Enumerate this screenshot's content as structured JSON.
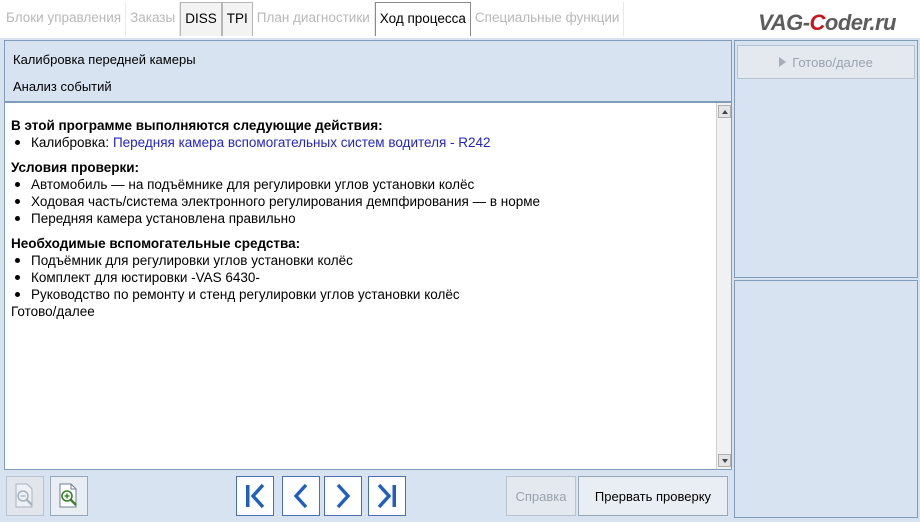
{
  "tabs": [
    {
      "label": "Блоки управления",
      "state": "disabled"
    },
    {
      "label": "Заказы",
      "state": "disabled"
    },
    {
      "label": "DISS",
      "state": "enabled"
    },
    {
      "label": "TPI",
      "state": "enabled"
    },
    {
      "label": "План диагностики",
      "state": "disabled"
    },
    {
      "label": "Ход процесса",
      "state": "active"
    },
    {
      "label": "Специальные функции",
      "state": "disabled"
    }
  ],
  "watermark": {
    "part1": "VAG-",
    "part2": "C",
    "part3": "oder.ru"
  },
  "header": {
    "title": "Калибровка передней камеры",
    "subtitle": "Анализ событий"
  },
  "content": {
    "section1_heading": "В этой программе выполняются следующие действия:",
    "section1_item_prefix": "Калибровка: ",
    "section1_item_link": "Передняя камера вспомогательных систем водителя - R242",
    "section2_heading": "Условия проверки:",
    "section2_items": [
      "Автомобиль — на подъёмнике для регулировки углов установки колёс",
      "Ходовая часть/система электронного регулирования демпфирования — в норме",
      "Передняя камера установлена правильно"
    ],
    "section3_heading": "Необходимые вспомогательные средства:",
    "section3_items": [
      "Подъёмник для регулировки углов установки колёс",
      "Комплект для юстировки -VAS 6430-",
      "Руководство по ремонту и стенд регулировки углов установки колёс"
    ],
    "footer_text": "Готово/далее"
  },
  "right_panel": {
    "next_button_label": "Готово/далее"
  },
  "toolbar": {
    "zoom_out_icon": "zoom-out-icon",
    "zoom_in_icon": "zoom-in-icon",
    "first_icon": "first-page-icon",
    "prev_icon": "previous-icon",
    "next_icon": "next-icon",
    "last_icon": "last-page-icon",
    "help_label": "Справка",
    "abort_label": "Прервать проверку"
  },
  "colors": {
    "background": "#d7e3f1",
    "link": "#2424c4",
    "nav_arrow": "#1f5fbf",
    "logo_red": "#c8161d"
  }
}
